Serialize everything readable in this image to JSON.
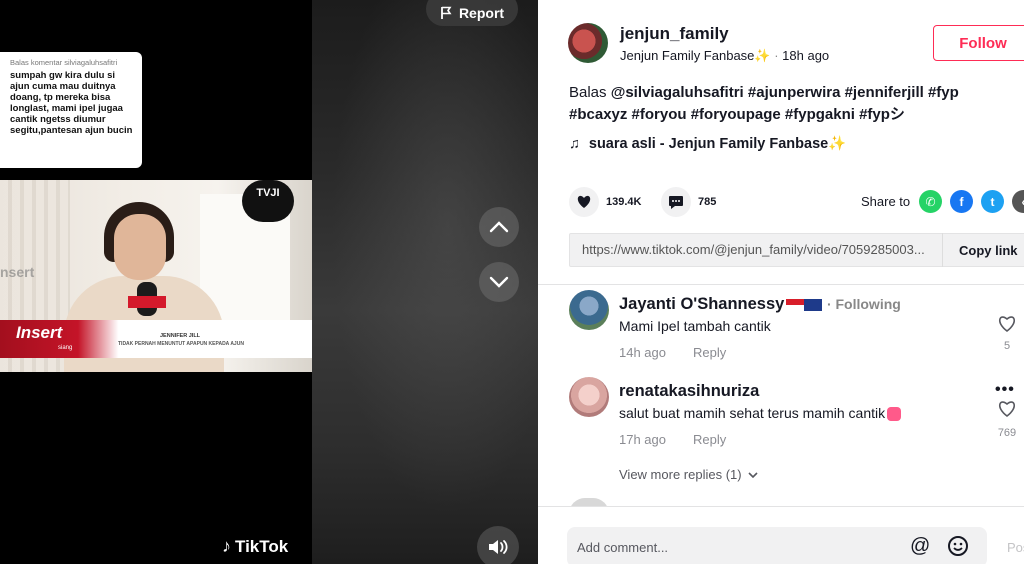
{
  "video": {
    "report_label": "Report",
    "tiktok_watermark": "TikTok",
    "reply_bubble": {
      "reply_to": "Balas komentar silviagaluhsafitri",
      "text": "sumpah gw kira dulu si ajun cuma mau duitnya doang, tp mereka bisa longlast, mami ipel jugaa cantik ngetss diumur segitu,pantesan ajun bucin"
    },
    "overlay": {
      "channel_logo": "TVJI",
      "brand": "Insert",
      "brand_sub": "siang",
      "watermark": "nsert",
      "lower_name": "JENNIFER JILL",
      "lower_caption": "TIDAK PERNAH MENUNTUT APAPUN KEPADA AJUN"
    }
  },
  "author": {
    "username": "jenjun_family",
    "display_name": "Jenjun Family Fanbase✨",
    "posted": "18h ago",
    "follow_label": "Follow"
  },
  "caption": {
    "prefix": "Balas ",
    "mention": "@silviagaluhsafitri",
    "hashtags": "#ajunperwira #jenniferjill #fyp #bcaxyz #foryou #foryoupage #fypgakni #fypシ"
  },
  "music": {
    "title": "suara asli - Jenjun Family Fanbase✨"
  },
  "stats": {
    "likes": "139.4K",
    "comments": "785",
    "share_label": "Share to"
  },
  "share_icons": [
    "whatsapp-icon",
    "facebook-icon",
    "twitter-icon",
    "embed-icon"
  ],
  "link": {
    "url": "https://www.tiktok.com/@jenjun_family/video/7059285003...",
    "copy_label": "Copy link"
  },
  "comments": [
    {
      "name": "Jayanti O'Shannessy",
      "badge": "· Following",
      "text": "Mami Ipel tambah cantik",
      "time": "14h ago",
      "reply_label": "Reply",
      "likes": "5"
    },
    {
      "name": "renatakasihnuriza",
      "text": "salut buat mamih sehat terus mamih cantik",
      "time": "17h ago",
      "reply_label": "Reply",
      "likes": "769"
    }
  ],
  "view_more": "View more replies (1)",
  "composer": {
    "placeholder": "Add comment...",
    "post_label": "Post"
  },
  "colors": {
    "accent": "#fe2c55",
    "text": "#161823",
    "muted": "#8a8b91"
  }
}
